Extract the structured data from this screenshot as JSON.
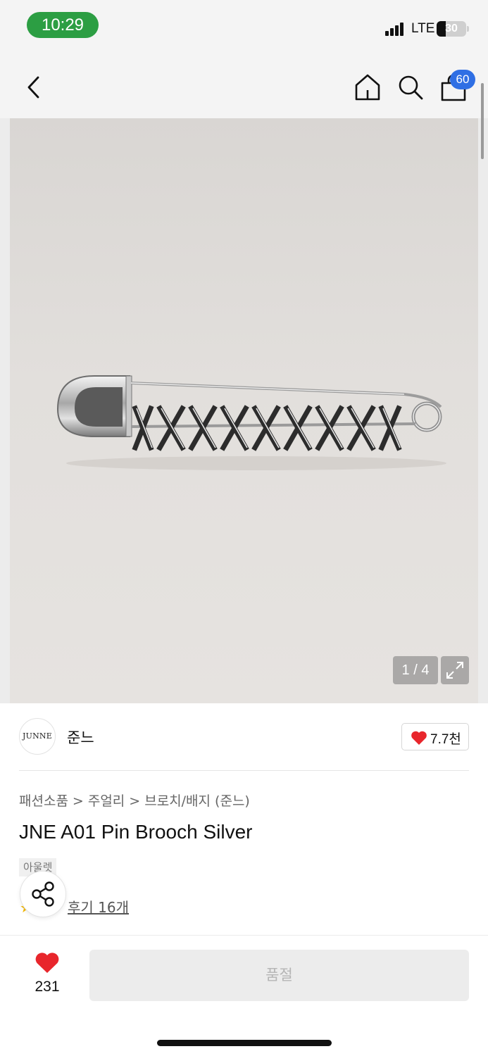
{
  "status_bar": {
    "time": "10:29",
    "network": "LTE",
    "battery": "30"
  },
  "nav": {
    "cart_count": "60"
  },
  "gallery": {
    "counter": "1 / 4"
  },
  "brand": {
    "logo_text": "JUNNE",
    "name": "준느",
    "like_count": "7.7천"
  },
  "breadcrumb": {
    "items": [
      "패션소품",
      "주얼리",
      "브로치/배지 (준느)"
    ],
    "separator": ">"
  },
  "product": {
    "title": "JNE A01 Pin Brooch Silver",
    "tag": "아울렛",
    "review_link": "후기 16개"
  },
  "bottom_bar": {
    "wish_count": "231",
    "soldout_label": "품절"
  },
  "colors": {
    "accent_heart": "#e8262c",
    "badge_blue": "#2f6fe4",
    "time_pill": "#2c9e43"
  }
}
